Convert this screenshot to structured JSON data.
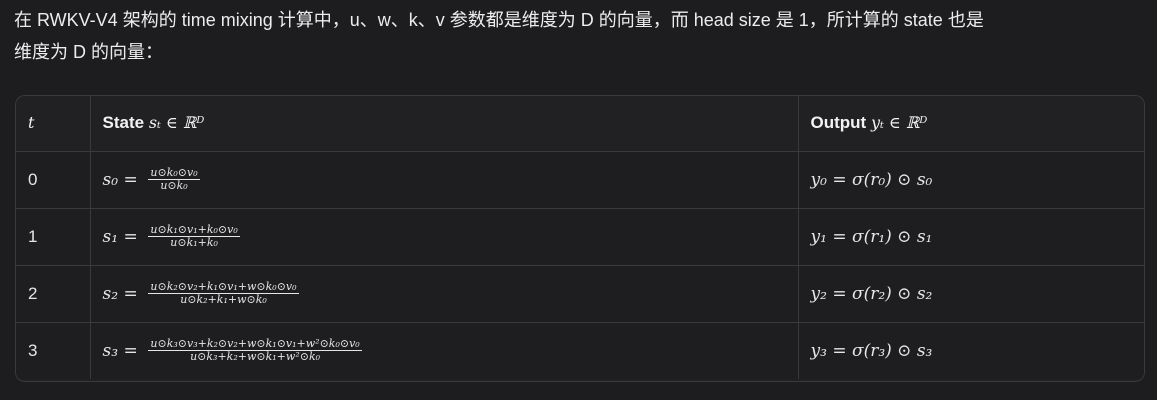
{
  "intro": {
    "line1": "在 RWKV-V4 架构的 time mixing 计算中，u、w、k、v 参数都是维度为 D 的向量，而 head size 是 1，所计算的 state 也是",
    "line2": "维度为 D 的向量："
  },
  "table": {
    "headers": {
      "t": "t",
      "state_label": "State",
      "state_math": "sₜ ∈ ℝᴰ",
      "output_label": "Output",
      "output_math": "yₜ ∈ ℝᴰ"
    },
    "rows": [
      {
        "t": "0",
        "state_lhs": "s₀ =",
        "state_num": "u⊙k₀⊙v₀",
        "state_den": "u⊙k₀",
        "output": "y₀ = σ(r₀) ⊙ s₀"
      },
      {
        "t": "1",
        "state_lhs": "s₁ =",
        "state_num": "u⊙k₁⊙v₁+k₀⊙v₀",
        "state_den": "u⊙k₁+k₀",
        "output": "y₁ = σ(r₁) ⊙ s₁"
      },
      {
        "t": "2",
        "state_lhs": "s₂ =",
        "state_num": "u⊙k₂⊙v₂+k₁⊙v₁+w⊙k₀⊙v₀",
        "state_den": "u⊙k₂+k₁+w⊙k₀",
        "output": "y₂ = σ(r₂) ⊙ s₂"
      },
      {
        "t": "3",
        "state_lhs": "s₃ =",
        "state_num": "u⊙k₃⊙v₃+k₂⊙v₂+w⊙k₁⊙v₁+w²⊙k₀⊙v₀",
        "state_den": "u⊙k₃+k₂+w⊙k₁+w²⊙k₀",
        "output": "y₃ = σ(r₃) ⊙ s₃"
      }
    ]
  }
}
